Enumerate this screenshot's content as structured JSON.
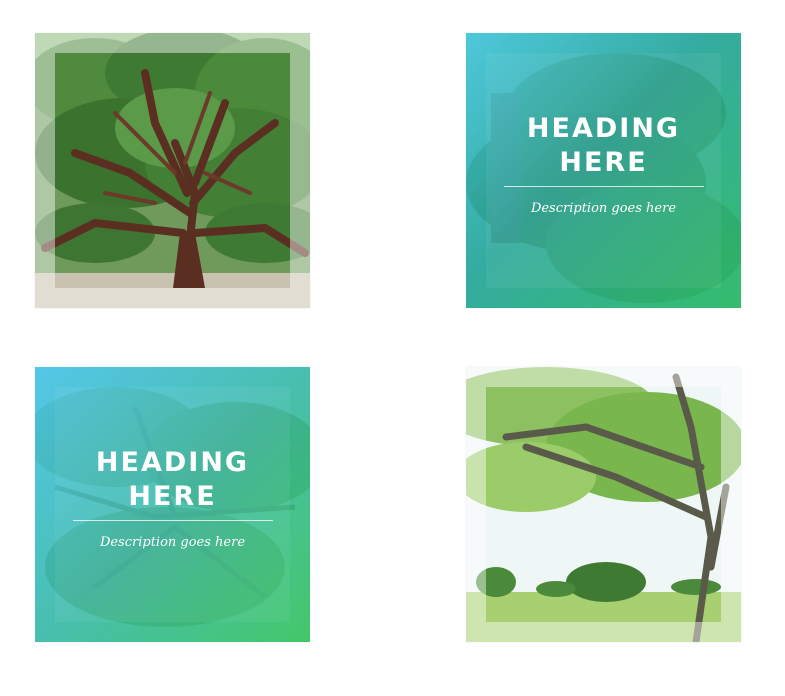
{
  "cards": [
    {
      "id": "top-left",
      "kind": "photo",
      "subject": "large spreading oak tree"
    },
    {
      "id": "top-right",
      "kind": "overlay",
      "heading": "HEADING HERE",
      "description": "Description goes here",
      "colors": {
        "from": "#4ccce6",
        "to": "#2ebe64"
      }
    },
    {
      "id": "bottom-left",
      "kind": "overlay",
      "heading": "HEADING HERE",
      "description": "Description goes here",
      "colors": {
        "from": "#50c8f0",
        "to": "#3cc85a"
      }
    },
    {
      "id": "bottom-right",
      "kind": "photo",
      "subject": "tree canopy over green lawn"
    }
  ]
}
